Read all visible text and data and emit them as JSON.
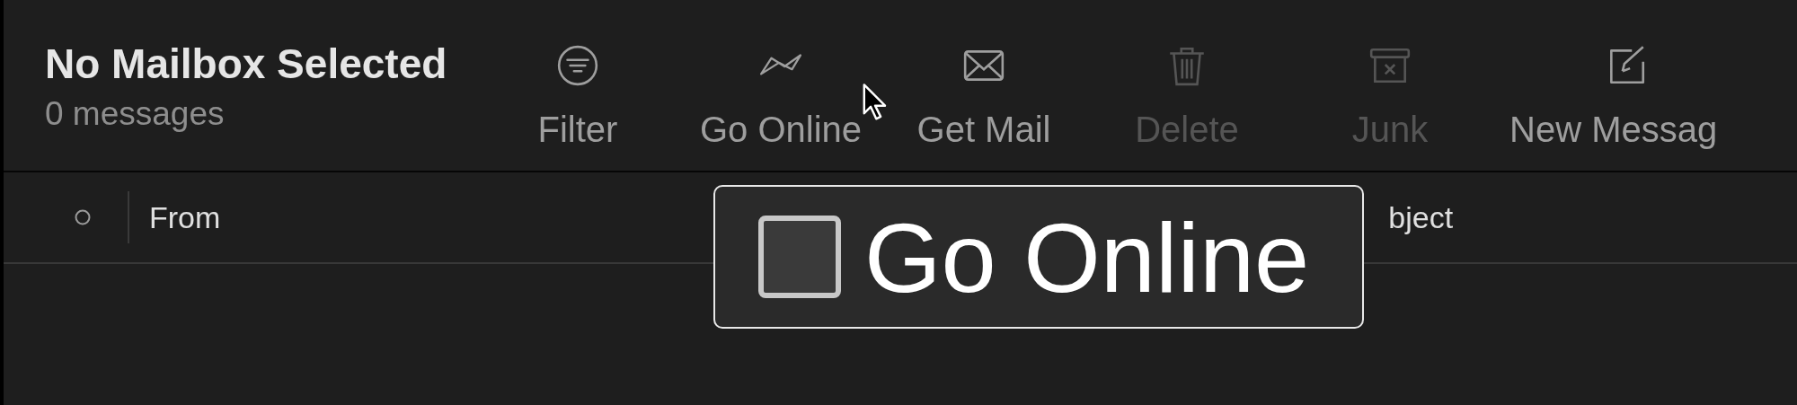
{
  "mailbox": {
    "title": "No Mailbox Selected",
    "count": "0 messages"
  },
  "toolbar": [
    {
      "kind": "filter",
      "label": "Filter",
      "disabled": false
    },
    {
      "kind": "online",
      "label": "Go Online",
      "disabled": false
    },
    {
      "kind": "mail",
      "label": "Get Mail",
      "disabled": false
    },
    {
      "kind": "trash",
      "label": "Delete",
      "disabled": true
    },
    {
      "kind": "junk",
      "label": "Junk",
      "disabled": true
    },
    {
      "kind": "compose",
      "label": "New Messag",
      "disabled": false
    }
  ],
  "columns": [
    {
      "label": "From"
    },
    {
      "label": "bject"
    }
  ],
  "tooltip": {
    "label": "Go Online",
    "checked": false
  }
}
